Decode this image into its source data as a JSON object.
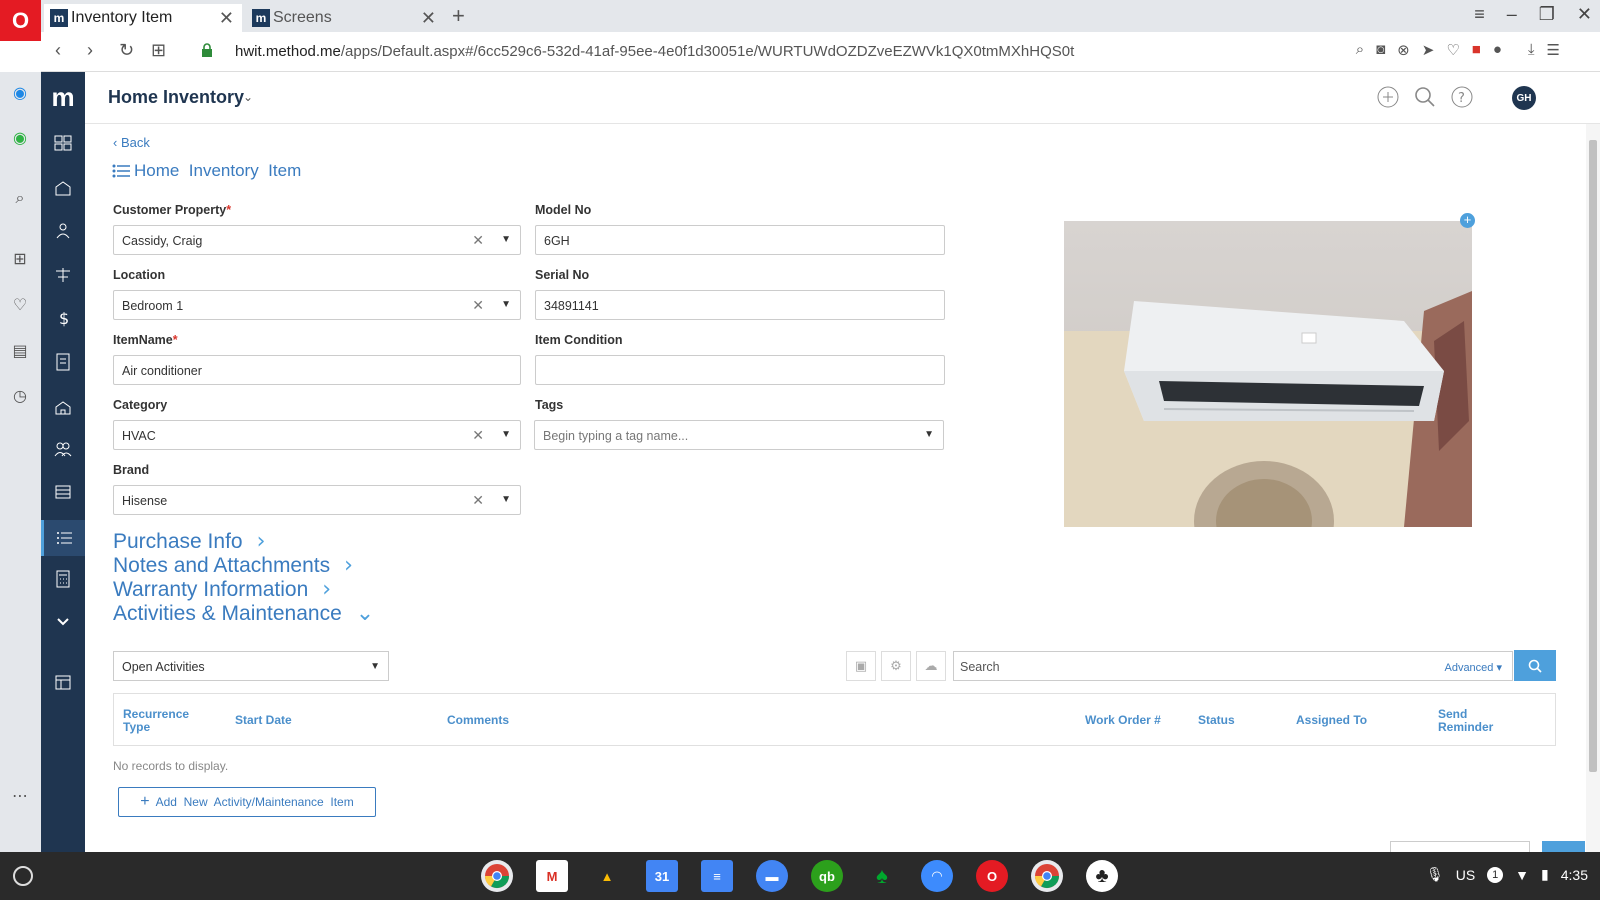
{
  "browser": {
    "tabs": [
      {
        "label": "Inventory Item",
        "favicon": "m"
      },
      {
        "label": "Screens",
        "favicon": "m"
      }
    ],
    "url_host": "hwit.method.me",
    "url_path": "/apps/Default.aspx#/6cc529c6-532d-41af-95ee-4e0f1d30051e/WURTUWdOZDZveEZWVk1QX0tmMXhHQS0t"
  },
  "header": {
    "title": "Home Inventory",
    "avatar": "GH"
  },
  "page": {
    "back_label": "Back",
    "title": "Home  Inventory  Item"
  },
  "form": {
    "customer_property": {
      "label": "Customer Property",
      "value": "Cassidy, Craig"
    },
    "location": {
      "label": "Location",
      "value": "Bedroom 1"
    },
    "item_name": {
      "label": "ItemName",
      "value": "Air conditioner"
    },
    "category": {
      "label": "Category",
      "value": "HVAC"
    },
    "brand": {
      "label": "Brand",
      "value": "Hisense"
    },
    "model_no": {
      "label": "Model No",
      "value": "6GH"
    },
    "serial_no": {
      "label": "Serial No",
      "value": "34891141"
    },
    "item_condition": {
      "label": "Item Condition",
      "value": ""
    },
    "tags": {
      "label": "Tags",
      "placeholder": "Begin typing a tag name..."
    }
  },
  "sections": [
    "Purchase Info",
    "Notes and Attachments",
    "Warranty Information",
    "Activities & Maintenance"
  ],
  "activities": {
    "filter": "Open Activities",
    "search_placeholder": "Search",
    "advanced_label": "Advanced ▾",
    "columns": [
      "Recurrence Type",
      "Start Date",
      "Comments",
      "Work Order #",
      "Status",
      "Assigned To",
      "Send Reminder"
    ],
    "empty_text": "No records to display.",
    "add_button": "Add  New  Activity/Maintenance  Item"
  },
  "tray": {
    "locale": "US",
    "notif_count": "1",
    "time": "4:35"
  },
  "colors": {
    "accent": "#3a7bbf",
    "sidebar": "#1f3550",
    "browser_brand": "#e41b23"
  }
}
